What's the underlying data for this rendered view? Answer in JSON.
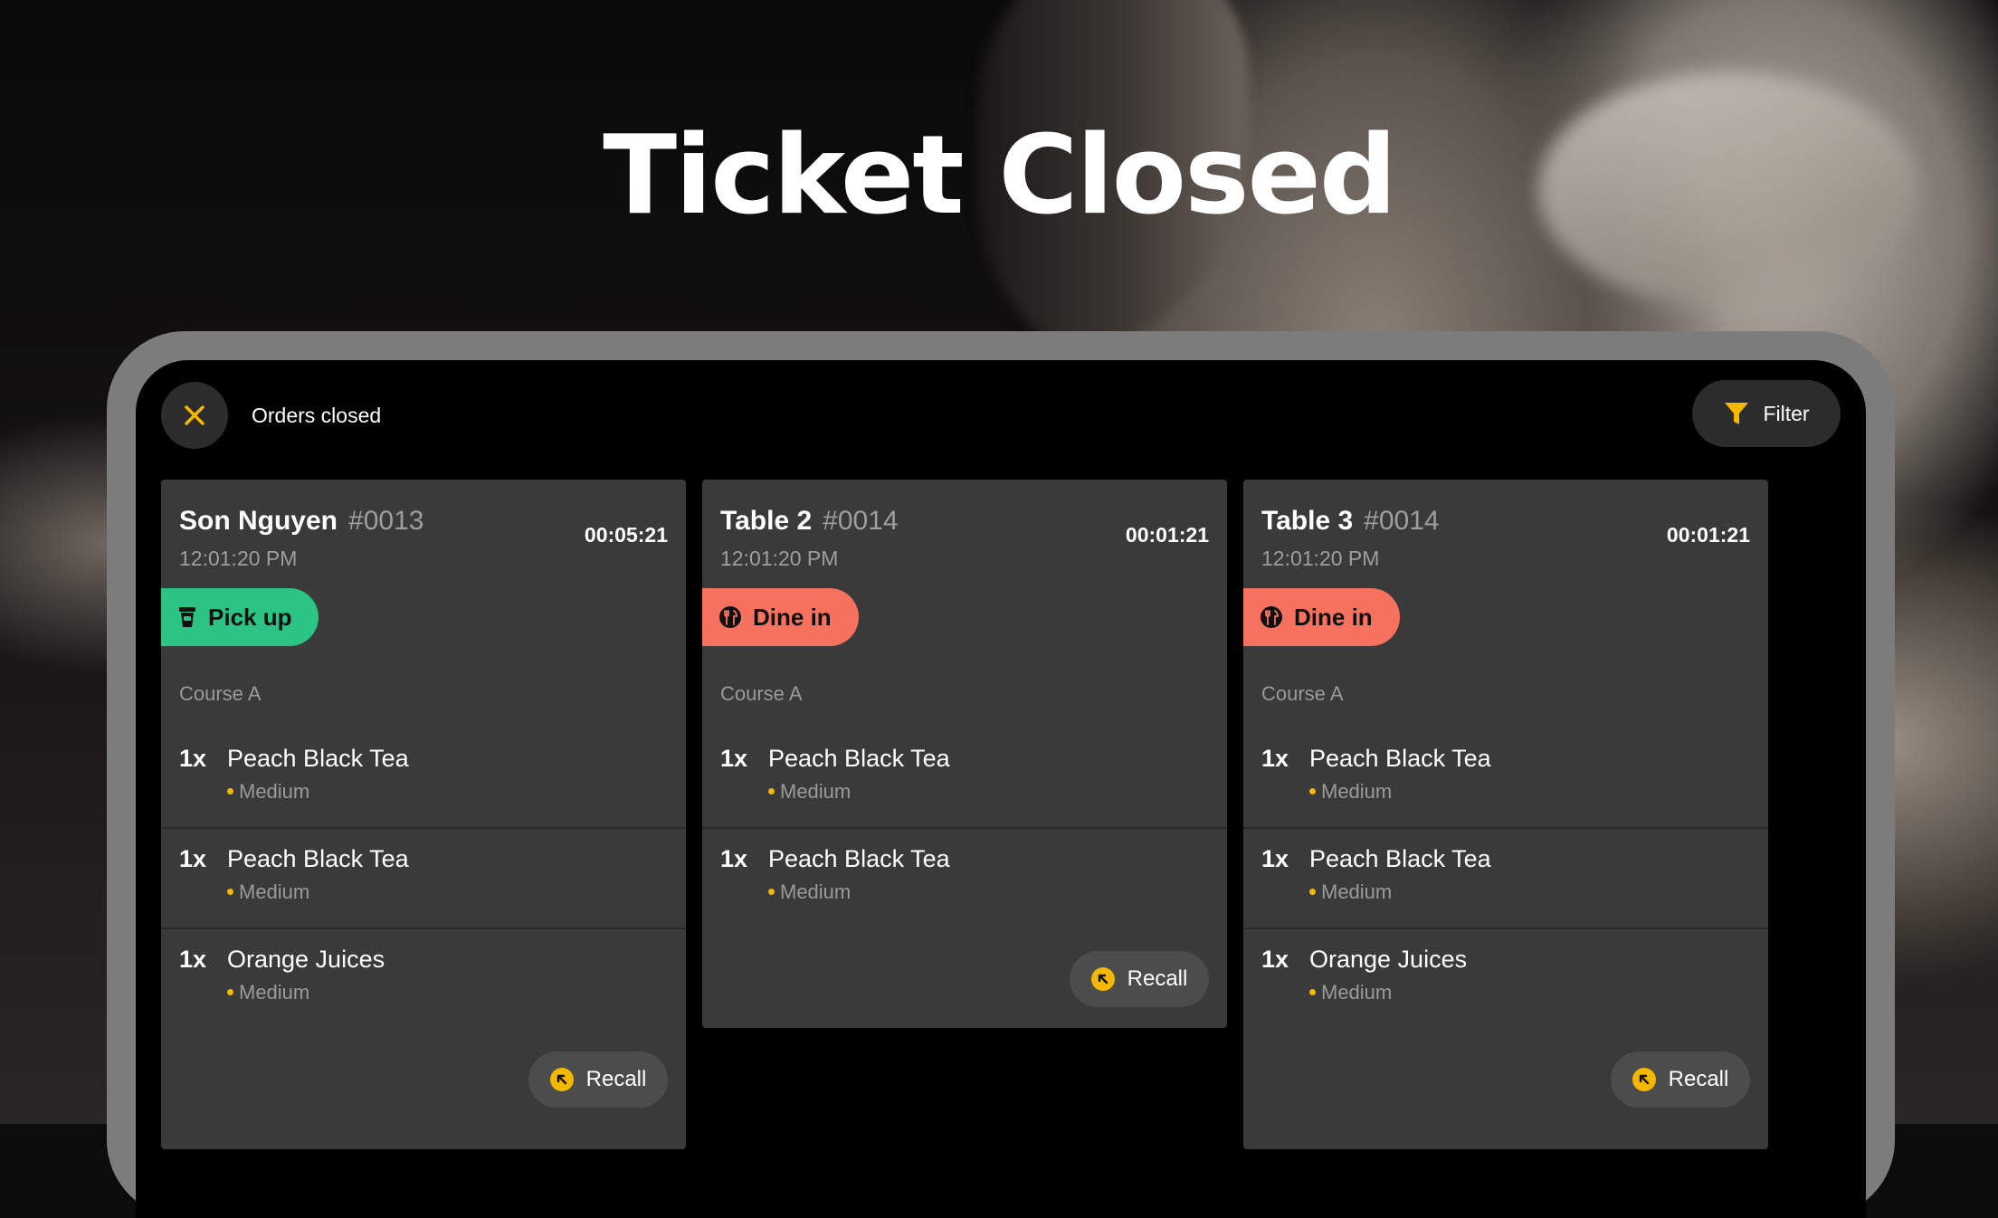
{
  "hero": {
    "title": "Ticket Closed"
  },
  "topbar": {
    "title": "Orders closed",
    "close_icon": "close-icon",
    "filter_label": "Filter",
    "filter_icon": "funnel-icon"
  },
  "colors": {
    "accent": "#f5b800",
    "pickup": "#2bc485",
    "dinein": "#f7725e",
    "card_bg": "#3a3a3a"
  },
  "cards": [
    {
      "name": "Son Nguyen",
      "number": "#0013",
      "time": "12:01:20 PM",
      "elapsed": "00:05:21",
      "type": "Pick up",
      "type_icon": "cup-icon",
      "course": "Course A",
      "items": [
        {
          "qty": "1x",
          "name": "Peach Black Tea",
          "modifier": "Medium"
        },
        {
          "qty": "1x",
          "name": "Peach Black Tea",
          "modifier": "Medium"
        },
        {
          "qty": "1x",
          "name": "Orange Juices",
          "modifier": "Medium"
        }
      ],
      "recall": "Recall"
    },
    {
      "name": "Table 2",
      "number": "#0014",
      "time": "12:01:20 PM",
      "elapsed": "00:01:21",
      "type": "Dine in",
      "type_icon": "dine-in-icon",
      "course": "Course A",
      "items": [
        {
          "qty": "1x",
          "name": "Peach Black Tea",
          "modifier": "Medium"
        },
        {
          "qty": "1x",
          "name": "Peach Black Tea",
          "modifier": "Medium"
        }
      ],
      "recall": "Recall"
    },
    {
      "name": "Table 3",
      "number": "#0014",
      "time": "12:01:20 PM",
      "elapsed": "00:01:21",
      "type": "Dine in",
      "type_icon": "dine-in-icon",
      "course": "Course A",
      "items": [
        {
          "qty": "1x",
          "name": "Peach Black Tea",
          "modifier": "Medium"
        },
        {
          "qty": "1x",
          "name": "Peach Black Tea",
          "modifier": "Medium"
        },
        {
          "qty": "1x",
          "name": "Orange Juices",
          "modifier": "Medium"
        }
      ],
      "recall": "Recall"
    }
  ]
}
